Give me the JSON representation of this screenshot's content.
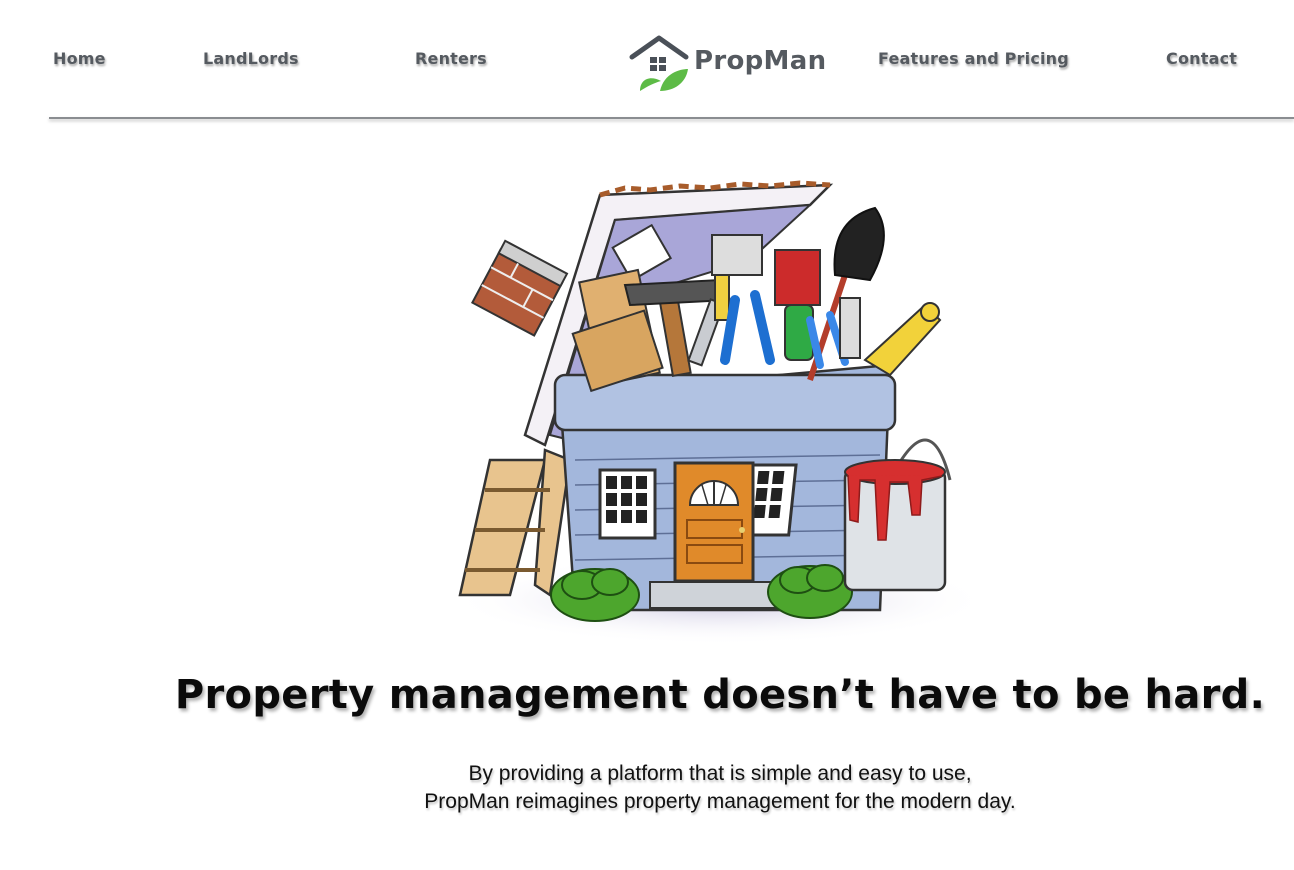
{
  "nav": {
    "home": "Home",
    "landlords": "LandLords",
    "renters": "Renters",
    "features": "Features and Pricing",
    "contact": "Contact"
  },
  "logo": {
    "text": "PropMan"
  },
  "hero": {
    "headline": "Property management doesn’t have to be hard.",
    "tagline_line1": "By providing a platform that is simple and easy to use,",
    "tagline_line2": "PropMan reimagines property management for the modern day."
  },
  "colors": {
    "nav_text": "#555a60",
    "logo_roof": "#4a5058",
    "logo_leaf": "#5dbb46",
    "headline": "#0b0b0b"
  },
  "icons": [
    "house-roof-icon",
    "leaf-icon",
    "window-icon"
  ]
}
